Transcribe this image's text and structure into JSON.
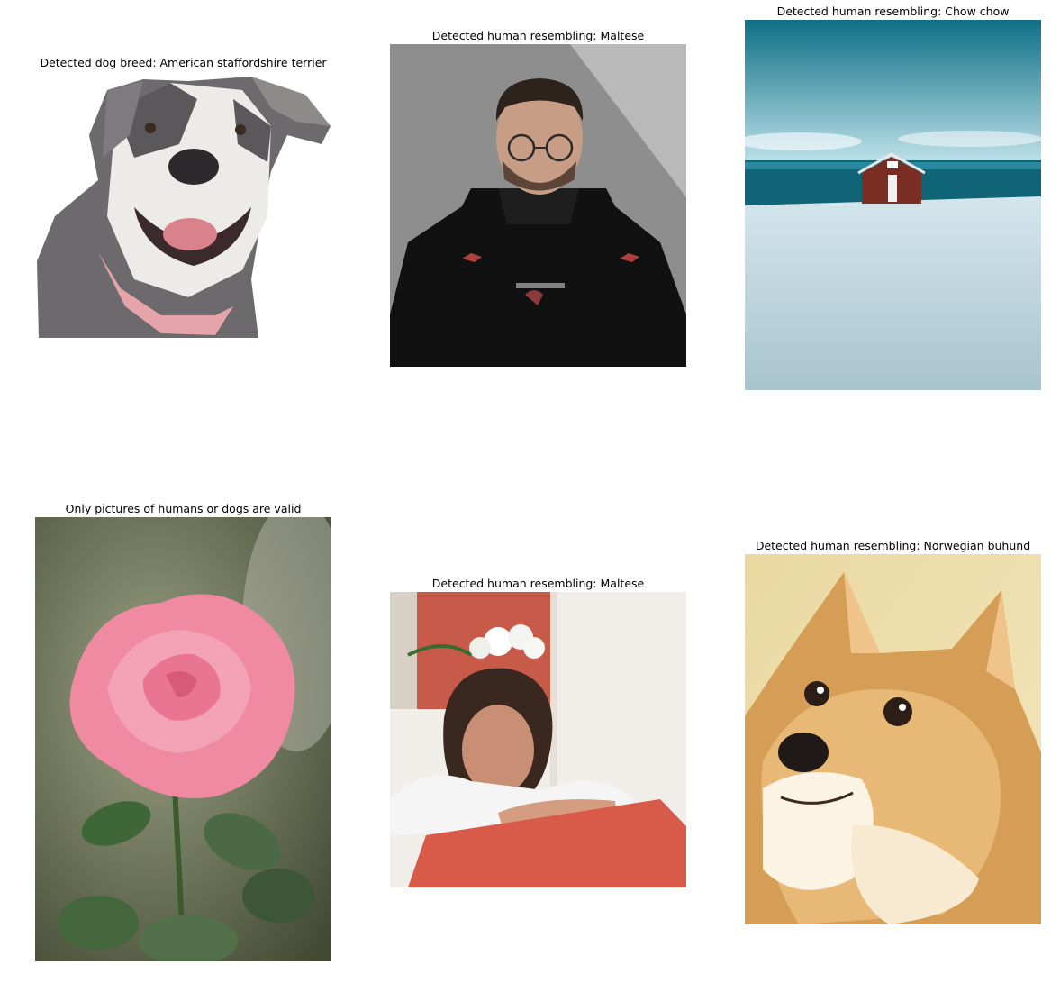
{
  "panels": [
    {
      "title": "Detected dog breed: American staffordshire terrier",
      "subject": "pit bull terrier dog"
    },
    {
      "title": "Detected human resembling: Maltese",
      "subject": "man with glasses in black hoodie"
    },
    {
      "title": "Detected human resembling: Chow chow",
      "subject": "red cabin on snowy beach"
    },
    {
      "title": "Only pictures of humans or dogs are valid",
      "subject": "pink rose"
    },
    {
      "title": "Detected human resembling: Maltese",
      "subject": "woman resting chin on red sofa"
    },
    {
      "title": "Detected human resembling: Norwegian buhund",
      "subject": "shiba inu dog"
    }
  ]
}
